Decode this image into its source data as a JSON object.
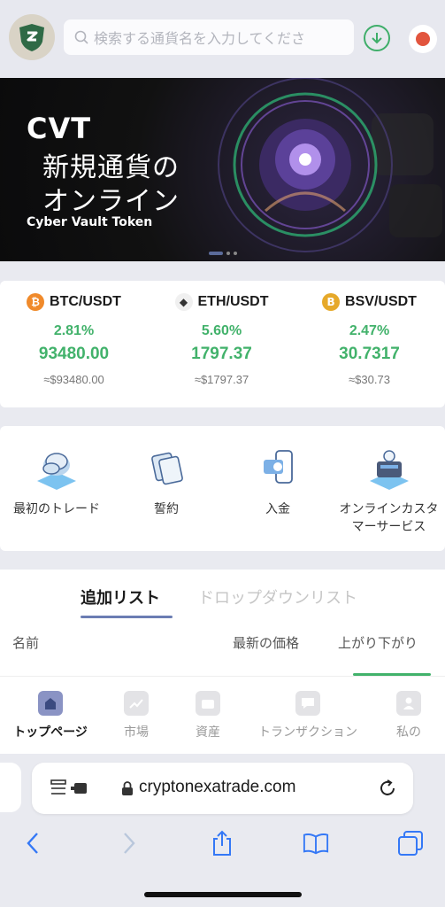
{
  "header": {
    "search_placeholder": "検索する通貨名を入力してくださ"
  },
  "banner": {
    "title": "CVT",
    "line1": "新規通貨の",
    "line2": "オンライン",
    "subtitle": "Cyber Vault Token"
  },
  "tickers": [
    {
      "pair": "BTC/USDT",
      "symbol": "₿",
      "color": "#f08a2b",
      "change": "2.81%",
      "price": "93480.00",
      "approx": "≈$93480.00"
    },
    {
      "pair": "ETH/USDT",
      "symbol": "◆",
      "color": "#f0f0f0",
      "change": "5.60%",
      "price": "1797.37",
      "approx": "≈$1797.37"
    },
    {
      "pair": "BSV/USDT",
      "symbol": "B",
      "color": "#e6a92a",
      "change": "2.47%",
      "price": "30.7317",
      "approx": "≈$30.73"
    }
  ],
  "actions": {
    "first_trade": "最初のトレード",
    "pledge": "誓約",
    "deposit": "入金",
    "support_line1": "オンラインカスタ",
    "support_line2": "マーサービス"
  },
  "list": {
    "tab_add": "追加リスト",
    "tab_dropdown": "ドロップダウンリスト",
    "col_name": "名前",
    "col_price": "最新の価格",
    "col_change": "上がり下がり"
  },
  "bottom_nav": {
    "home": "トップページ",
    "market": "市場",
    "assets": "資産",
    "transactions": "トランザクション",
    "mine": "私の"
  },
  "browser": {
    "url": "cryptonexatrade.com"
  },
  "colors": {
    "accent_green": "#42b26b",
    "tab_underline": "#6b7db3"
  }
}
